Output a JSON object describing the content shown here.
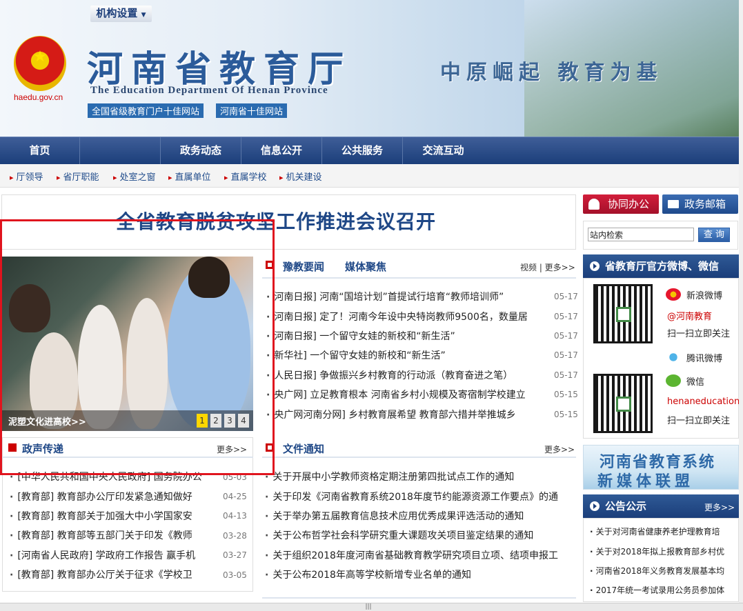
{
  "header": {
    "title": "河南省教育厅",
    "subtitle": "The Education Department Of Henan Province",
    "domain": "haedu.gov.cn",
    "awards": [
      "全国省级教育门户十佳网站",
      "河南省十佳网站"
    ],
    "slogan": "中原崛起 教育为基"
  },
  "nav": {
    "items": [
      "首页",
      "机构设置",
      "政务动态",
      "信息公开",
      "公共服务",
      "交流互动"
    ],
    "active": "机构设置"
  },
  "subnav": [
    "厅领导",
    "省厅职能",
    "处室之窗",
    "直属单位",
    "直属学校",
    "机关建设"
  ],
  "headline": "全省教育脱贫攻坚工作推进会议召开",
  "slideshow": {
    "caption": "泥塑文化进高校>>",
    "pages": [
      "1",
      "2",
      "3",
      "4"
    ],
    "active_page": "1"
  },
  "news": {
    "tabs": [
      "豫教要闻",
      "媒体聚焦"
    ],
    "links": "视频 | 更多>>",
    "items": [
      {
        "title": "河南日报] 河南“国培计划”首提试行培育“教师培训师”",
        "date": "05-17"
      },
      {
        "title": "河南日报] 定了！河南今年设中央特岗教师9500名，数量居",
        "date": "05-17"
      },
      {
        "title": "河南日报] 一个留守女娃的新校和“新生活”",
        "date": "05-17"
      },
      {
        "title": "新华社] 一个留守女娃的新校和“新生活”",
        "date": "05-17"
      },
      {
        "title": "人民日报] 争做振兴乡村教育的行动派（教育奋进之笔）",
        "date": "05-17"
      },
      {
        "title": "央广网] 立足教育根本 河南省乡村小规模及寄宿制学校建立",
        "date": "05-15"
      },
      {
        "title": "央广网河南分网] 乡村教育展希望 教育部六措并举推城乡",
        "date": "05-15"
      }
    ]
  },
  "policy": {
    "title": "政声传递",
    "more": "更多>>",
    "items": [
      {
        "title": "[中华人民共和国中央人民政府] 国务院办公",
        "date": "05-03"
      },
      {
        "title": "[教育部] 教育部办公厅印发紧急通知做好",
        "date": "04-25"
      },
      {
        "title": "[教育部] 教育部关于加强大中小学国家安",
        "date": "04-13"
      },
      {
        "title": "[教育部] 教育部等五部门关于印发《教师",
        "date": "03-28"
      },
      {
        "title": "[河南省人民政府] 学政府工作报告 赢手机",
        "date": "03-27"
      },
      {
        "title": "[教育部] 教育部办公厅关于征求《学校卫",
        "date": "03-05"
      }
    ]
  },
  "docs": {
    "title": "文件通知",
    "more": "更多>>",
    "items": [
      "关于开展中小学教师资格定期注册第四批试点工作的通知",
      "关于印发《河南省教育系统2018年度节约能源资源工作要点》的通",
      "关于举办第五届教育信息技术应用优秀成果评选活动的通知",
      "关于公布哲学社会科学研究重大课题攻关项目鉴定结果的通知",
      "关于组织2018年度河南省基础教育教学研究项目立项、结项申报工",
      "关于公布2018年高等学校新增专业名单的通知"
    ]
  },
  "sidebar": {
    "btn_office": "协同办公",
    "btn_mail": "政务邮箱",
    "search_placeholder": "站内检索",
    "search_btn": "查 询",
    "weibo_title": "省教育厅官方微博、微信",
    "sina": "新浪微博",
    "sina_account": "@河南教育",
    "scan1": "扫一扫立即关注",
    "tencent": "腾讯微博",
    "wechat": "微信",
    "wechat_account": "henaneducation",
    "scan2": "扫一扫立即关注",
    "media_line1": "河南省教育系统",
    "media_line2": "新媒体联盟",
    "notice_title": "公告公示",
    "notice_more": "更多>>",
    "notices": [
      "关于对河南省健康养老护理教育培",
      "关于对2018年拟上报教育部乡村优",
      "河南省2018年义务教育发展基本均",
      "2017年统一考试录用公务员参加体"
    ]
  },
  "colors": {
    "brand_blue": "#1b3e7a",
    "accent_red": "#c00000",
    "highlight_box": "#e0141e"
  }
}
